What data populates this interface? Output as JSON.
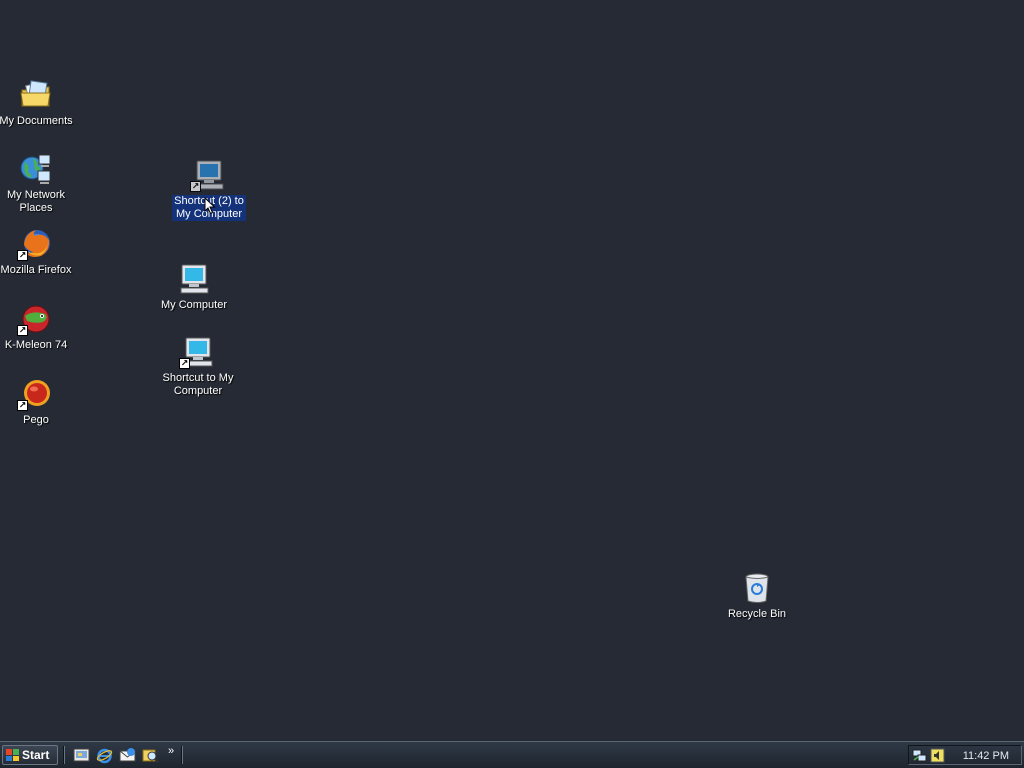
{
  "desktop": {
    "background_color": "#252a34",
    "icons": [
      {
        "label": "My Documents",
        "icon": "my-documents-icon"
      },
      {
        "label": "My Network\nPlaces",
        "icon": "network-places-icon"
      },
      {
        "label": "Mozilla Firefox",
        "icon": "firefox-icon"
      },
      {
        "label": "K-Meleon 74",
        "icon": "k-meleon-icon"
      },
      {
        "label": "Pego",
        "icon": "pego-icon"
      },
      {
        "label": "Shortcut (2) to\nMy Computer",
        "icon": "computer-shortcut-icon",
        "selected": true
      },
      {
        "label": "My Computer",
        "icon": "my-computer-icon"
      },
      {
        "label": "Shortcut to My\nComputer",
        "icon": "computer-shortcut-icon"
      },
      {
        "label": "Recycle Bin",
        "icon": "recycle-bin-icon"
      }
    ]
  },
  "taskbar": {
    "start_label": "Start",
    "quick_launch": [
      "show-desktop-icon",
      "internet-explorer-icon",
      "outlook-express-icon",
      "search-icon"
    ],
    "overflow_label": "»",
    "tray_icons": [
      "network-icon",
      "volume-icon"
    ],
    "clock": "11:42 PM"
  }
}
